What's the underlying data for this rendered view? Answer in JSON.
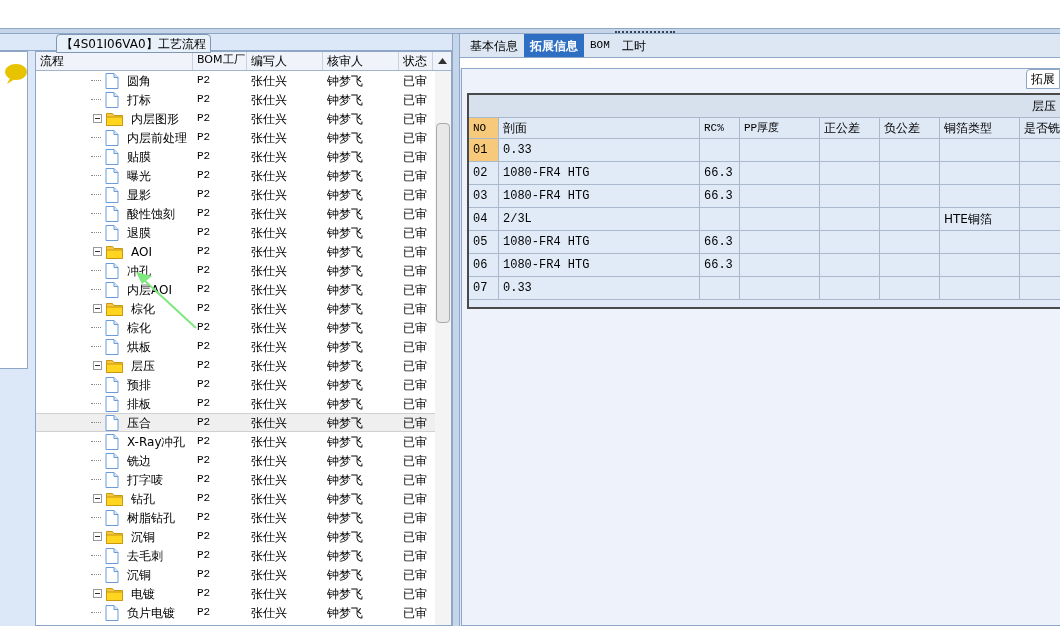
{
  "left_panel": {
    "title": "【4S01I06VA0】工艺流程",
    "columns": [
      "流程",
      "BOM工厂",
      "编写人",
      "核审人",
      "状态"
    ],
    "tree": [
      {
        "label": "圆角",
        "kind": "leaf",
        "bom": "P2",
        "author": "张仕兴",
        "reviewer": "钟梦飞",
        "status": "已审",
        "selected": false
      },
      {
        "label": "打标",
        "kind": "leaf",
        "bom": "P2",
        "author": "张仕兴",
        "reviewer": "钟梦飞",
        "status": "已审",
        "selected": false
      },
      {
        "label": "内层图形",
        "kind": "folder",
        "expanded": true,
        "bom": "P2",
        "author": "张仕兴",
        "reviewer": "钟梦飞",
        "status": "已审",
        "selected": false,
        "children": [
          {
            "label": "内层前处理",
            "kind": "leaf",
            "bom": "P2",
            "author": "张仕兴",
            "reviewer": "钟梦飞",
            "status": "已审",
            "selected": false
          },
          {
            "label": "贴膜",
            "kind": "leaf",
            "bom": "P2",
            "author": "张仕兴",
            "reviewer": "钟梦飞",
            "status": "已审",
            "selected": false
          },
          {
            "label": "曝光",
            "kind": "leaf",
            "bom": "P2",
            "author": "张仕兴",
            "reviewer": "钟梦飞",
            "status": "已审",
            "selected": false
          },
          {
            "label": "显影",
            "kind": "leaf",
            "bom": "P2",
            "author": "张仕兴",
            "reviewer": "钟梦飞",
            "status": "已审",
            "selected": false
          },
          {
            "label": "酸性蚀刻",
            "kind": "leaf",
            "bom": "P2",
            "author": "张仕兴",
            "reviewer": "钟梦飞",
            "status": "已审",
            "selected": false
          },
          {
            "label": "退膜",
            "kind": "leaf",
            "bom": "P2",
            "author": "张仕兴",
            "reviewer": "钟梦飞",
            "status": "已审",
            "selected": false
          }
        ]
      },
      {
        "label": "AOI",
        "kind": "folder",
        "expanded": true,
        "bom": "P2",
        "author": "张仕兴",
        "reviewer": "钟梦飞",
        "status": "已审",
        "selected": false,
        "children": [
          {
            "label": "冲孔",
            "kind": "leaf",
            "bom": "P2",
            "author": "张仕兴",
            "reviewer": "钟梦飞",
            "status": "已审",
            "selected": false
          },
          {
            "label": "内层AOI",
            "kind": "leaf",
            "bom": "P2",
            "author": "张仕兴",
            "reviewer": "钟梦飞",
            "status": "已审",
            "selected": false
          }
        ]
      },
      {
        "label": "棕化",
        "kind": "folder",
        "expanded": true,
        "bom": "P2",
        "author": "张仕兴",
        "reviewer": "钟梦飞",
        "status": "已审",
        "selected": false,
        "children": [
          {
            "label": "棕化",
            "kind": "leaf",
            "bom": "P2",
            "author": "张仕兴",
            "reviewer": "钟梦飞",
            "status": "已审",
            "selected": false
          },
          {
            "label": "烘板",
            "kind": "leaf",
            "bom": "P2",
            "author": "张仕兴",
            "reviewer": "钟梦飞",
            "status": "已审",
            "selected": false
          }
        ]
      },
      {
        "label": "层压",
        "kind": "folder",
        "expanded": true,
        "bom": "P2",
        "author": "张仕兴",
        "reviewer": "钟梦飞",
        "status": "已审",
        "selected": false,
        "children": [
          {
            "label": "预排",
            "kind": "leaf",
            "bom": "P2",
            "author": "张仕兴",
            "reviewer": "钟梦飞",
            "status": "已审",
            "selected": false
          },
          {
            "label": "排板",
            "kind": "leaf",
            "bom": "P2",
            "author": "张仕兴",
            "reviewer": "钟梦飞",
            "status": "已审",
            "selected": false
          },
          {
            "label": "压合",
            "kind": "leaf",
            "bom": "P2",
            "author": "张仕兴",
            "reviewer": "钟梦飞",
            "status": "已审",
            "selected": true
          },
          {
            "label": "X-Ray冲孔",
            "kind": "leaf",
            "bom": "P2",
            "author": "张仕兴",
            "reviewer": "钟梦飞",
            "status": "已审",
            "selected": false
          },
          {
            "label": "铣边",
            "kind": "leaf",
            "bom": "P2",
            "author": "张仕兴",
            "reviewer": "钟梦飞",
            "status": "已审",
            "selected": false
          },
          {
            "label": "打字唛",
            "kind": "leaf",
            "bom": "P2",
            "author": "张仕兴",
            "reviewer": "钟梦飞",
            "status": "已审",
            "selected": false
          }
        ]
      },
      {
        "label": "钻孔",
        "kind": "folder",
        "expanded": true,
        "bom": "P2",
        "author": "张仕兴",
        "reviewer": "钟梦飞",
        "status": "已审",
        "selected": false,
        "children": [
          {
            "label": "树脂钻孔",
            "kind": "leaf",
            "bom": "P2",
            "author": "张仕兴",
            "reviewer": "钟梦飞",
            "status": "已审",
            "selected": false
          }
        ]
      },
      {
        "label": "沉铜",
        "kind": "folder",
        "expanded": true,
        "bom": "P2",
        "author": "张仕兴",
        "reviewer": "钟梦飞",
        "status": "已审",
        "selected": false,
        "children": [
          {
            "label": "去毛刺",
            "kind": "leaf",
            "bom": "P2",
            "author": "张仕兴",
            "reviewer": "钟梦飞",
            "status": "已审",
            "selected": false
          },
          {
            "label": "沉铜",
            "kind": "leaf",
            "bom": "P2",
            "author": "张仕兴",
            "reviewer": "钟梦飞",
            "status": "已审",
            "selected": false
          }
        ]
      },
      {
        "label": "电镀",
        "kind": "folder",
        "expanded": true,
        "bom": "P2",
        "author": "张仕兴",
        "reviewer": "钟梦飞",
        "status": "已审",
        "selected": false,
        "children": [
          {
            "label": "负片电镀",
            "kind": "leaf",
            "bom": "P2",
            "author": "张仕兴",
            "reviewer": "钟梦飞",
            "status": "已审",
            "selected": false
          }
        ]
      }
    ]
  },
  "right_panel": {
    "tabs": [
      {
        "label": "基本信息",
        "selected": false
      },
      {
        "label": "拓展信息",
        "selected": true
      },
      {
        "label": "BOM",
        "selected": false
      },
      {
        "label": "工时",
        "selected": false
      }
    ],
    "sub_button": "拓展",
    "group_header": "层压",
    "columns": [
      "NO",
      "剖面",
      "RC%",
      "PP厚度",
      "正公差",
      "负公差",
      "铜箔类型",
      "是否铣"
    ],
    "rows": [
      {
        "no": "01",
        "section": "0.33",
        "selected": true
      },
      {
        "no": "02",
        "section": "1080-FR4 HTG",
        "rc": "66.3",
        "selected": false
      },
      {
        "no": "03",
        "section": "1080-FR4 HTG",
        "rc": "66.3",
        "selected": false
      },
      {
        "no": "04",
        "section": "2/3L",
        "foil": "HTE铜箔",
        "selected": false
      },
      {
        "no": "05",
        "section": "1080-FR4 HTG",
        "rc": "66.3",
        "selected": false
      },
      {
        "no": "06",
        "section": "1080-FR4 HTG",
        "rc": "66.3",
        "selected": false
      },
      {
        "no": "07",
        "section": "0.33",
        "selected": false
      }
    ]
  }
}
